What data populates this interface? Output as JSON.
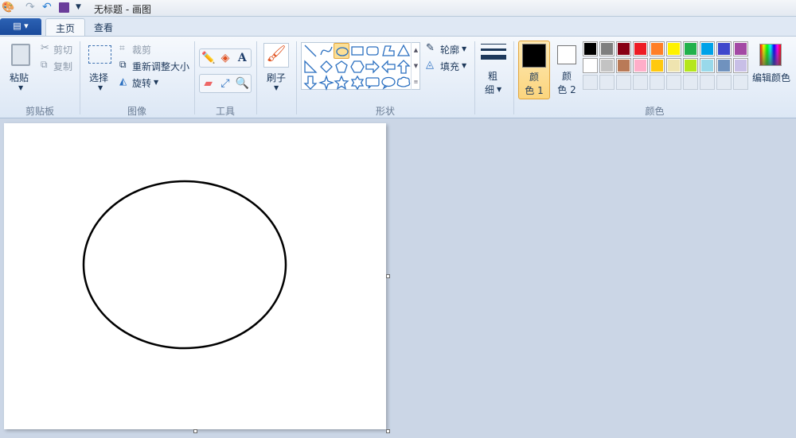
{
  "window": {
    "title": "无标题 - 画图"
  },
  "quick_access": {
    "icons": [
      "paint-app-icon",
      "redo-icon",
      "undo-icon",
      "save-icon",
      "customize-dropdown-icon"
    ]
  },
  "tabs": [
    {
      "label": "主页",
      "active": true
    },
    {
      "label": "查看",
      "active": false
    }
  ],
  "clipboard": {
    "paste": "粘贴",
    "cut": "剪切",
    "copy": "复制",
    "label": "剪贴板"
  },
  "image": {
    "select": "选择",
    "crop": "裁剪",
    "resize": "重新调整大小",
    "rotate": "旋转",
    "label": "图像"
  },
  "tools": {
    "label": "工具",
    "items": [
      "pencil",
      "fill",
      "text",
      "eraser",
      "color-picker",
      "magnifier"
    ],
    "text_glyph": "A"
  },
  "brushes": {
    "label": "刷子"
  },
  "shapes": {
    "label": "形状",
    "outline": "轮廓",
    "fill": "填充",
    "selected": "oval"
  },
  "size": {
    "line1": "粗",
    "line2": "细"
  },
  "colors": {
    "label": "颜色",
    "color1": {
      "line1": "颜",
      "line2": "色 1",
      "value": "#000000"
    },
    "color2": {
      "line1": "颜",
      "line2": "色 2",
      "value": "#ffffff"
    },
    "edit": "编辑颜色",
    "palette": [
      [
        "#000000",
        "#7f7f7f",
        "#880015",
        "#ed1c24",
        "#ff7f27",
        "#fff200",
        "#22b14c",
        "#00a2e8",
        "#3f48cc",
        "#a349a4"
      ],
      [
        "#ffffff",
        "#c3c3c3",
        "#b97a57",
        "#ffaec9",
        "#ffc90e",
        "#efe4b0",
        "#b5e61d",
        "#99d9ea",
        "#7092be",
        "#c8bfe7"
      ]
    ],
    "custom_slots": 10
  }
}
